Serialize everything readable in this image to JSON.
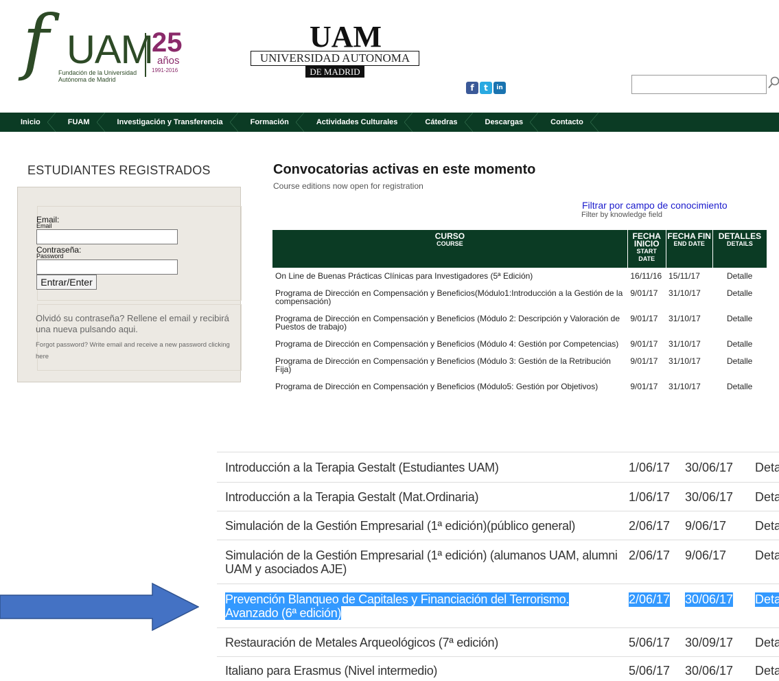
{
  "header": {
    "fuam_logo": {
      "letters": "fUAM",
      "number": "25",
      "anos": "años",
      "years": "1991-2016",
      "subtitle": "Fundación de la Universidad Autónoma de Madrid"
    },
    "uam_logo": {
      "letters": "UAM",
      "line1": "UNIVERSIDAD AUTONOMA",
      "line2": "DE MADRID"
    },
    "social": [
      "facebook-icon",
      "twitter-icon",
      "linkedin-icon"
    ],
    "search": {
      "value": "",
      "placeholder": ""
    }
  },
  "nav": {
    "items": [
      "Inicio",
      "FUAM",
      "Investigación y Transferencia",
      "Formación",
      "Actividades Culturales",
      "Cátedras",
      "Descargas",
      "Contacto"
    ]
  },
  "login": {
    "title": "ESTUDIANTES REGISTRADOS",
    "email_label": "Email:",
    "email_sub": "Email",
    "password_label": "Contraseña:",
    "password_sub": "Password",
    "button": "Entrar/Enter",
    "forgot_es": "Olvidó su contraseña? Rellene el email y recibirá una nueva pulsando aqui.",
    "forgot_en": "Forgot password? Write email and receive a new password clicking here"
  },
  "convocatorias": {
    "title": "Convocatorias activas en este momento",
    "subtitle": "Course editions now open for registration",
    "filter_link": "Filtrar por campo de conocimiento",
    "filter_sub": "Filter by knowledge field",
    "columns": {
      "curso": "CURSO",
      "curso_sub": "COURSE",
      "inicio": "FECHA INICIO",
      "inicio_sub": "START DATE",
      "fin": "FECHA FIN",
      "fin_sub": "END DATE",
      "detalles": "DETALLES",
      "detalles_sub": "DETAILS"
    },
    "rows": [
      {
        "course": "On Line de Buenas Prácticas Clínicas para Investigadores (5ª Edición)",
        "start": "16/11/16",
        "end": "15/11/17",
        "detail": "Detalle"
      },
      {
        "course": "Programa de Dirección en Compensación y Beneficios(Módulo1:Introducción a la Gestión de la compensación)",
        "start": "9/01/17",
        "end": "31/10/17",
        "detail": "Detalle"
      },
      {
        "course": "Programa de Dirección en Compensación y Beneficios (Módulo 2: Descripción y Valoración de Puestos de trabajo)",
        "start": "9/01/17",
        "end": "31/10/17",
        "detail": "Detalle"
      },
      {
        "course": "Programa de Dirección en Compensación y Beneficios (Módulo 4: Gestión por Competencias)",
        "start": "9/01/17",
        "end": "31/10/17",
        "detail": "Detalle"
      },
      {
        "course": "Programa de Dirección en Compensación y Beneficios (Módulo 3: Gestión de la Retribución Fija)",
        "start": "9/01/17",
        "end": "31/10/17",
        "detail": "Detalle"
      },
      {
        "course": "Programa de Dirección en Compensación y Beneficios (Módulo5: Gestión por Objetivos)",
        "start": "9/01/17",
        "end": "31/10/17",
        "detail": "Detalle"
      }
    ]
  },
  "zoom": {
    "rows": [
      {
        "course": "Introducción a la Terapia Gestalt (Estudiantes UAM)",
        "start": "1/06/17",
        "end": "30/06/17",
        "detail": "Deta"
      },
      {
        "course": "Introducción a la Terapia Gestalt (Mat.Ordinaria)",
        "start": "1/06/17",
        "end": "30/06/17",
        "detail": "Deta"
      },
      {
        "course": "Simulación de la Gestión Empresarial (1ª edición)(público general)",
        "start": "2/06/17",
        "end": "9/06/17",
        "detail": "Deta"
      },
      {
        "course": "Simulación de la Gestión Empresarial (1ª edición) (alumanos UAM, alumni UAM y asociados AJE)",
        "start": "2/06/17",
        "end": "9/06/17",
        "detail": "Deta"
      },
      {
        "course": "Prevención Blanqueo de Capitales y Financiación del Terrorismo. Avanzado (6ª edición)",
        "start": "2/06/17",
        "end": "30/06/17",
        "detail": "Deta"
      },
      {
        "course": "Restauración de Metales Arqueológicos (7ª edición)",
        "start": "5/06/17",
        "end": "30/09/17",
        "detail": "Deta"
      },
      {
        "course": "Italiano para Erasmus (Nivel intermedio)",
        "start": "5/06/17",
        "end": "30/06/17",
        "detail": "Deta"
      }
    ],
    "highlighted_index": 4
  },
  "colors": {
    "nav_bg": "#0b3b24",
    "brand_green": "#2d4a26",
    "brand_purple": "#8a2a6a",
    "detail_green": "#2e7d32",
    "link_blue": "#1a1acc",
    "highlight": "#3399ff",
    "arrow": "#4472c4"
  }
}
